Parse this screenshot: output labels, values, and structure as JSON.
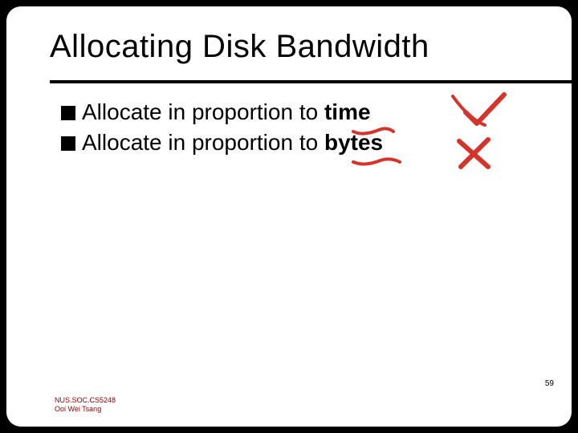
{
  "title": "Allocating Disk Bandwidth",
  "bullets": [
    {
      "pre": "Allocate in proportion to ",
      "bold": "time"
    },
    {
      "pre": "Allocate in proportion to ",
      "bold": "bytes"
    }
  ],
  "page_number": "59",
  "footer_line1": "NUS.SOC.CS5248",
  "footer_line2": "Ooi Wei Tsang",
  "annotation_color": "#d4342a"
}
